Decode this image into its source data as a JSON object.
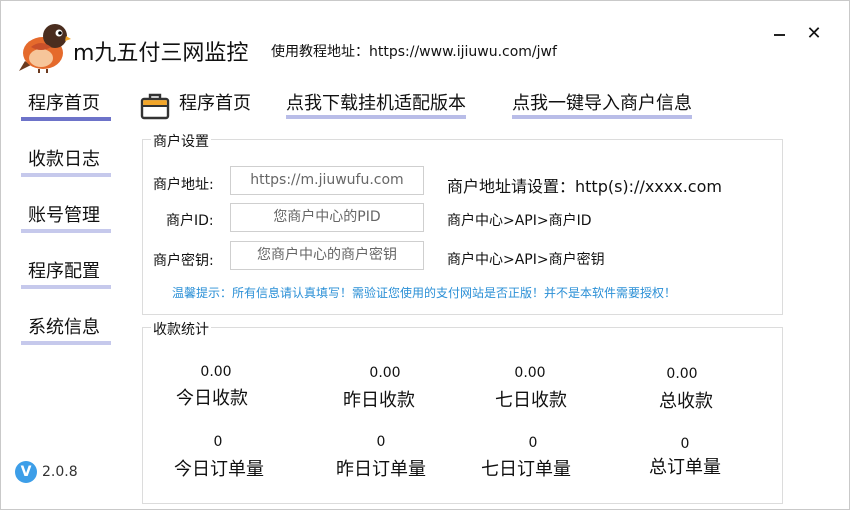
{
  "header": {
    "app_title": "m九五付三网监控",
    "tutorial_label": "使用教程地址：",
    "tutorial_url": "https://www.ijiuwu.com/jwf"
  },
  "window_controls": {
    "close": "✕"
  },
  "sidebar": {
    "items": [
      {
        "label": "程序首页",
        "active": true
      },
      {
        "label": "收款日志"
      },
      {
        "label": "账号管理"
      },
      {
        "label": "程序配置"
      },
      {
        "label": "系统信息"
      }
    ]
  },
  "tabs": {
    "home": "程序首页",
    "download": "点我下载挂机适配版本",
    "import": "点我一键导入商户信息"
  },
  "merchant": {
    "title": "商户设置",
    "address_label": "商户地址:",
    "address_placeholder": "https://m.jiuwufu.com",
    "address_hint": "商户地址请设置：http(s)://xxxx.com",
    "id_label": "商户ID:",
    "id_placeholder": "您商户中心的PID",
    "id_hint": "商户中心>API>商户ID",
    "key_label": "商户密钥:",
    "key_placeholder": "您商户中心的商户密钥",
    "key_hint": "商户中心>API>商户密钥",
    "notice": "温馨提示：所有信息请认真填写！需验证您使用的支付网站是否正版！并不是本软件需要授权！"
  },
  "stats": {
    "title": "收款统计",
    "amounts": [
      {
        "value": "0.00",
        "label": "今日收款"
      },
      {
        "value": "0.00",
        "label": "昨日收款"
      },
      {
        "value": "0.00",
        "label": "七日收款"
      },
      {
        "value": "0.00",
        "label": "总收款"
      }
    ],
    "orders": [
      {
        "value": "0",
        "label": "今日订单量"
      },
      {
        "value": "0",
        "label": "昨日订单量"
      },
      {
        "value": "0",
        "label": "七日订单量"
      },
      {
        "value": "0",
        "label": "总订单量"
      }
    ]
  },
  "version": {
    "icon_letter": "V",
    "number": "2.0.8"
  },
  "colors": {
    "accent": "#6d73c9",
    "accent_light": "#c6c9ec",
    "notice": "#2a8fd6",
    "version_icon": "#3d9ee8"
  }
}
